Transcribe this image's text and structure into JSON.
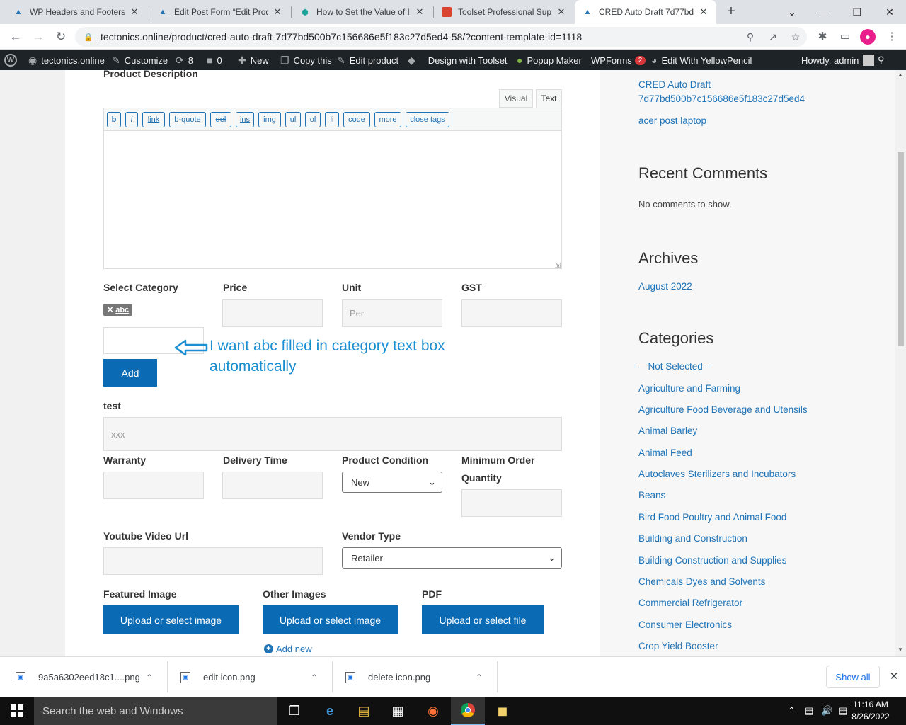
{
  "browser": {
    "tabs": [
      {
        "title": "WP Headers and Footers"
      },
      {
        "title": "Edit Post Form “Edit Produ"
      },
      {
        "title": "How to Set the Value of In"
      },
      {
        "title": "Toolset Professional Supp"
      },
      {
        "title": "CRED Auto Draft 7d77bd"
      }
    ],
    "url": "tectonics.online/product/cred-auto-draft-7d77bd500b7c156686e5f183c27d5ed4-58/?content-template-id=1118"
  },
  "adminbar": {
    "site": "tectonics.online",
    "customize": "Customize",
    "updates": "8",
    "comments": "0",
    "new": "New",
    "copy": "Copy this",
    "edit": "Edit product",
    "toolset": "Design with Toolset",
    "popup": "Popup Maker",
    "wpforms": "WPForms",
    "wpforms_badge": "2",
    "yellowpencil": "Edit With YellowPencil",
    "howdy": "Howdy, admin"
  },
  "form": {
    "product_description": "Product Description",
    "editor_tabs": {
      "visual": "Visual",
      "text": "Text"
    },
    "quicktags": [
      "b",
      "i",
      "link",
      "b-quote",
      "del",
      "ins",
      "img",
      "ul",
      "ol",
      "li",
      "code",
      "more",
      "close tags"
    ],
    "select_category": "Select Category",
    "price": "Price",
    "unit": "Unit",
    "unit_placeholder": "Per",
    "gst": "GST",
    "category_tag": "abc",
    "add_button": "Add",
    "test": "test",
    "test_value": "xxx",
    "warranty": "Warranty",
    "delivery_time": "Delivery Time",
    "product_condition": "Product Condition",
    "product_condition_value": "New",
    "minimum_order": "Minimum Order",
    "quantity": "Quantity",
    "youtube": "Youtube Video Url",
    "vendor_type": "Vendor Type",
    "vendor_type_value": "Retailer",
    "featured_image": "Featured Image",
    "other_images": "Other Images",
    "pdf": "PDF",
    "upload_image": "Upload or select image",
    "upload_file": "Upload or select file",
    "add_new": "Add new"
  },
  "annotation": {
    "line1": "I want abc filled in category text box",
    "line2": "automatically"
  },
  "sidebar": {
    "recent_posts": [
      "CRED Auto Draft",
      "7d77bd500b7c156686e5f183c27d5ed4",
      "acer post laptop"
    ],
    "recent_comments_title": "Recent Comments",
    "no_comments": "No comments to show.",
    "archives_title": "Archives",
    "archive_item": "August 2022",
    "categories_title": "Categories",
    "categories": [
      "—Not Selected—",
      "Agriculture and Farming",
      "Agriculture Food Beverage and Utensils",
      "Animal Barley",
      "Animal Feed",
      "Autoclaves Sterilizers and Incubators",
      "Beans",
      "Bird Food Poultry and Animal Food",
      "Building and Construction",
      "Building Construction and Supplies",
      "Chemicals Dyes and Solvents",
      "Commercial Refrigerator",
      "Consumer Electronics",
      "Crop Yield Booster"
    ]
  },
  "downloads": {
    "items": [
      "9a5a6302eed18c1....png",
      "edit icon.png",
      "delete icon.png"
    ],
    "show_all": "Show all"
  },
  "taskbar": {
    "search": "Search the web and Windows",
    "time": "11:16 AM",
    "date": "8/26/2022"
  }
}
